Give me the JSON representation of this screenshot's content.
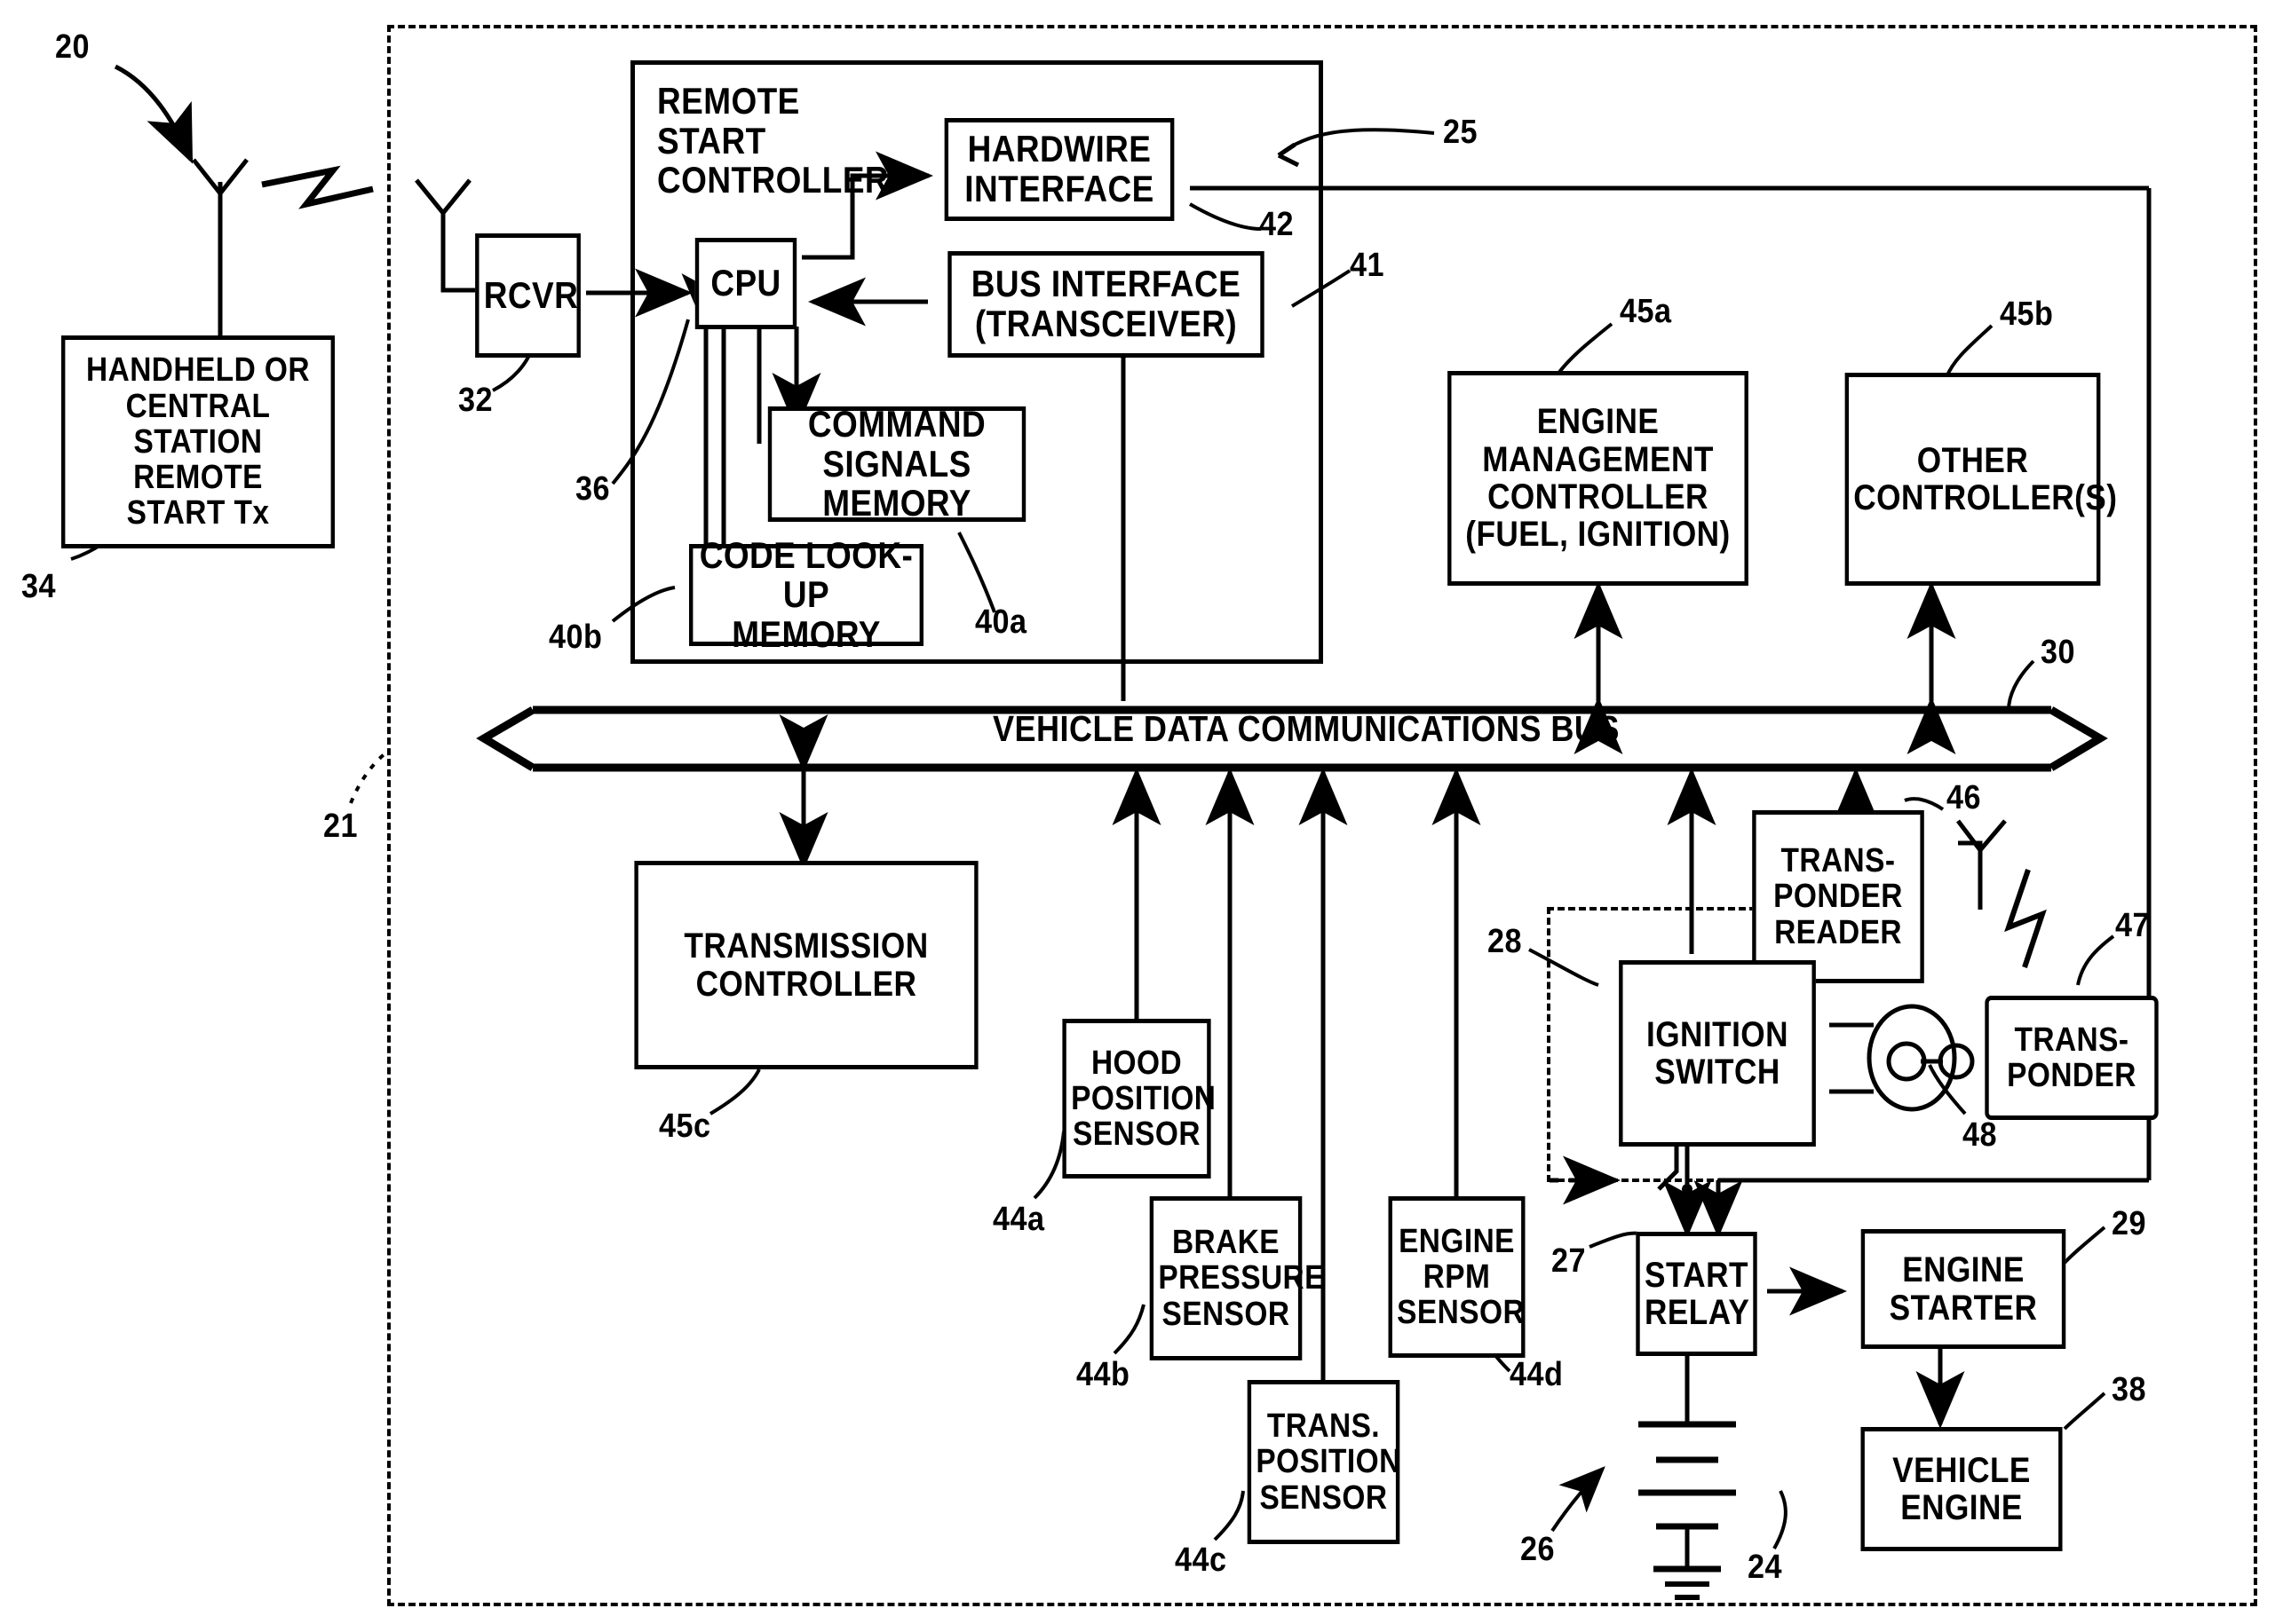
{
  "figure": {
    "type": "patent-block-diagram",
    "system_ref": "20",
    "vehicle_boundary_ref": "21"
  },
  "blocks": {
    "handheld_tx": {
      "label": "HANDHELD OR\nCENTRAL\nSTATION REMOTE\nSTART Tx",
      "ref": "34"
    },
    "rcvr": {
      "label": "RCVR",
      "ref": "32"
    },
    "remote_start_controller": {
      "label": "REMOTE\nSTART\nCONTROLLER",
      "ref": "25"
    },
    "cpu": {
      "label": "CPU",
      "ref": "36"
    },
    "hardwire_interface": {
      "label": "HARDWIRE\nINTERFACE",
      "ref": "42"
    },
    "bus_interface": {
      "label": "BUS INTERFACE\n(TRANSCEIVER)",
      "ref": "41"
    },
    "command_signals_memory": {
      "label": "COMMAND\nSIGNALS MEMORY",
      "ref": "40a"
    },
    "code_lookup_memory": {
      "label": "CODE LOOK-UP\nMEMORY",
      "ref": "40b"
    },
    "engine_management_controller": {
      "label": "ENGINE\nMANAGEMENT\nCONTROLLER\n(FUEL, IGNITION)",
      "ref": "45a"
    },
    "other_controllers": {
      "label": "OTHER\nCONTROLLER(S)",
      "ref": "45b"
    },
    "vehicle_data_bus": {
      "label": "VEHICLE DATA COMMUNICATIONS BUS",
      "ref": "30"
    },
    "transmission_controller": {
      "label": "TRANSMISSION\nCONTROLLER",
      "ref": "45c"
    },
    "hood_position_sensor": {
      "label": "HOOD\nPOSITION\nSENSOR",
      "ref": "44a"
    },
    "brake_pressure_sensor": {
      "label": "BRAKE\nPRESSURE\nSENSOR",
      "ref": "44b"
    },
    "trans_position_sensor": {
      "label": "TRANS.\nPOSITION\nSENSOR",
      "ref": "44c"
    },
    "engine_rpm_sensor": {
      "label": "ENGINE\nRPM\nSENSOR",
      "ref": "44d"
    },
    "transponder_reader": {
      "label": "TRANS-\nPONDER\nREADER",
      "ref": "46"
    },
    "transponder": {
      "label": "TRANS-\nPONDER",
      "ref": "47"
    },
    "ignition_switch": {
      "label": "IGNITION\nSWITCH",
      "ref": "28"
    },
    "key": {
      "label": "",
      "ref": "48"
    },
    "start_relay": {
      "label": "START\nRELAY",
      "ref": "27"
    },
    "battery": {
      "label": "",
      "ref": "24"
    },
    "battery_arrow": {
      "label": "",
      "ref": "26"
    },
    "engine_starter": {
      "label": "ENGINE\nSTARTER",
      "ref": "29"
    },
    "vehicle_engine": {
      "label": "VEHICLE\nENGINE",
      "ref": "38"
    }
  },
  "refs": {
    "r20": "20",
    "r21": "21",
    "r24": "24",
    "r25": "25",
    "r26": "26",
    "r27": "27",
    "r28": "28",
    "r29": "29",
    "r30": "30",
    "r32": "32",
    "r34": "34",
    "r36": "36",
    "r38": "38",
    "r40a": "40a",
    "r40b": "40b",
    "r41": "41",
    "r42": "42",
    "r44a": "44a",
    "r44b": "44b",
    "r44c": "44c",
    "r44d": "44d",
    "r45a": "45a",
    "r45b": "45b",
    "r45c": "45c",
    "r46": "46",
    "r47": "47",
    "r48": "48"
  },
  "colors": {
    "ink": "#000000",
    "paper": "#ffffff"
  }
}
